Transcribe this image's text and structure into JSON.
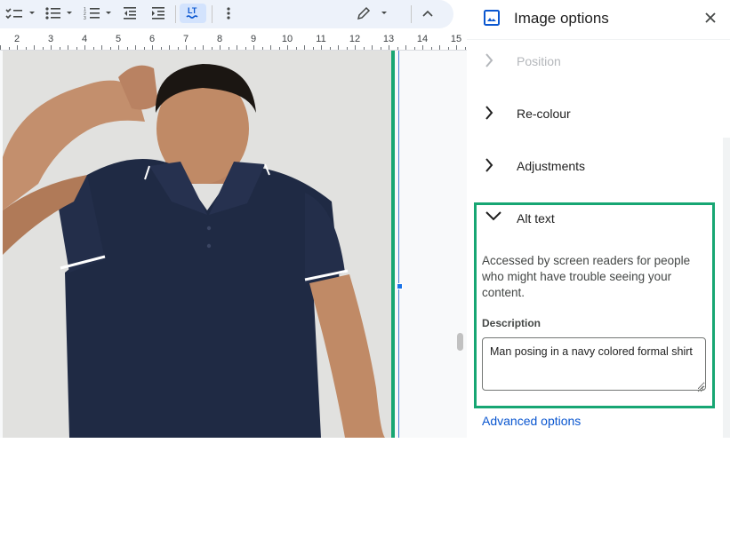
{
  "toolbar": {
    "items": [
      "checklist-icon",
      "bulleted-list-icon",
      "numbered-list-icon",
      "decrease-indent-icon",
      "increase-indent-icon",
      "clear-formatting-icon",
      "more-options-icon",
      "edit-mode-icon",
      "collapse-icon"
    ]
  },
  "ruler": {
    "numbers": [
      "2",
      "3",
      "4",
      "5",
      "6",
      "7",
      "8",
      "9",
      "10",
      "11",
      "12",
      "13",
      "14",
      "15"
    ]
  },
  "document": {
    "image_alt": "Man posing in a navy colored formal shirt"
  },
  "panel": {
    "title": "Image options",
    "close_icon": "close-icon",
    "sections": [
      {
        "label": "Position",
        "state": "collapsed",
        "faded": true
      },
      {
        "label": "Re-colour",
        "state": "collapsed"
      },
      {
        "label": "Adjustments",
        "state": "collapsed"
      },
      {
        "label": "Alt text",
        "state": "expanded"
      }
    ],
    "alt_text": {
      "heading": "Alt text",
      "help": "Accessed by screen readers for people who might have trouble seeing your content.",
      "description_label": "Description",
      "description_value": "Man posing in a navy colored formal shirt"
    },
    "advanced_link": "Advanced options"
  },
  "colors": {
    "accent_green": "#17a673",
    "link_blue": "#0b57d0",
    "toolbar_bg": "#edf2fa",
    "shirt_navy": "#1f2a44"
  }
}
